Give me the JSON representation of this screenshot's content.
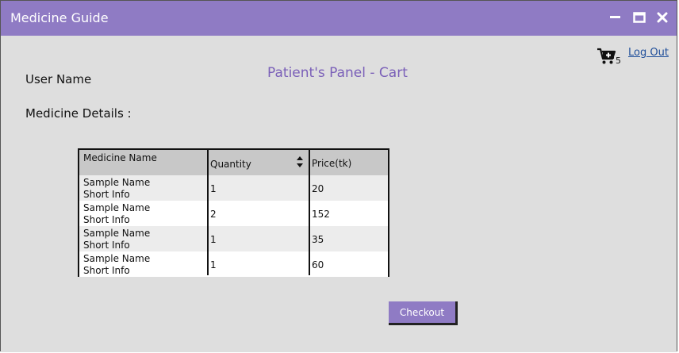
{
  "window": {
    "title": "Medicine Guide"
  },
  "header": {
    "cart_count": "5",
    "logout_label": "Log Out"
  },
  "panel": {
    "title": "Patient's Panel - Cart",
    "user_name_label": "User Name",
    "medicine_details_label": "Medicine Details :"
  },
  "table": {
    "columns": [
      "Medicine Name",
      "Quantity",
      "Price(tk)"
    ],
    "rows": [
      {
        "name": "Sample Name",
        "info": "Short Info",
        "quantity": "1",
        "price": "20"
      },
      {
        "name": "Sample Name",
        "info": "Short Info",
        "quantity": "2",
        "price": "152"
      },
      {
        "name": "Sample Name",
        "info": "Short Info",
        "quantity": "1",
        "price": "35"
      },
      {
        "name": "Sample Name",
        "info": "Short Info",
        "quantity": "1",
        "price": "60"
      }
    ]
  },
  "actions": {
    "checkout_label": "Checkout"
  },
  "colors": {
    "accent": "#8f7bc4",
    "title_text": "#7a5fb8",
    "link": "#1f4e9a",
    "background": "#dedede"
  },
  "icons": [
    "minimize-icon",
    "maximize-icon",
    "close-icon",
    "cart-icon",
    "sort-icon"
  ]
}
